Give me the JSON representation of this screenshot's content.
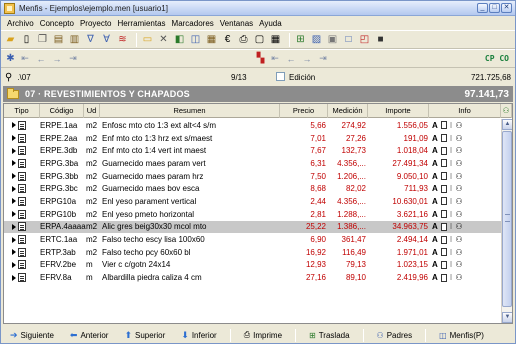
{
  "window": {
    "title": "Menfis - Ejemplos\\ejemplo.men  [usuario1]",
    "controls": [
      "_",
      "□",
      "✕"
    ]
  },
  "menu": [
    "Archivo",
    "Concepto",
    "Proyecto",
    "Herramientas",
    "Marcadores",
    "Ventanas",
    "Ayuda"
  ],
  "toolbar2": {
    "code": "CP CO"
  },
  "pathbar": {
    "path": ".\\07",
    "pager": "9/13",
    "edit_label": "Edición",
    "total": "721.725,68"
  },
  "chapter": {
    "title": "07 · REVESTIMIENTOS Y CHAPADOS",
    "total": "97.141,73"
  },
  "columns": [
    "Tipo",
    "Código",
    "Ud",
    "Resumen",
    "Precio",
    "Medición",
    "Importe",
    "Info"
  ],
  "rows": [
    {
      "code": "ERPE.1aa",
      "ud": "m2",
      "resumen": "Enfosc mto cto 1:3 ext alt<4 s/m",
      "precio": "5,66",
      "medicion": "274,92",
      "importe": "1.556,05"
    },
    {
      "code": "ERPE.2aa",
      "ud": "m2",
      "resumen": "Enf mto cto 1:3 hrz ext s/maest",
      "precio": "7,01",
      "medicion": "27,26",
      "importe": "191,09"
    },
    {
      "code": "ERPE.3db",
      "ud": "m2",
      "resumen": "Enf mto cto 1:4 vert int maest",
      "precio": "7,67",
      "medicion": "132,73",
      "importe": "1.018,04"
    },
    {
      "code": "ERPG.3ba",
      "ud": "m2",
      "resumen": "Guarnecido maes param vert",
      "precio": "6,31",
      "medicion": "4.356,...",
      "importe": "27.491,34"
    },
    {
      "code": "ERPG.3bb",
      "ud": "m2",
      "resumen": "Guarnecido maes param hrz",
      "precio": "7,50",
      "medicion": "1.206,...",
      "importe": "9.050,10"
    },
    {
      "code": "ERPG.3bc",
      "ud": "m2",
      "resumen": "Guarnecido maes bov esca",
      "precio": "8,68",
      "medicion": "82,02",
      "importe": "711,93"
    },
    {
      "code": "ERPG10a",
      "ud": "m2",
      "resumen": "Enl yeso parament vertical",
      "precio": "2,44",
      "medicion": "4.356,...",
      "importe": "10.630,01"
    },
    {
      "code": "ERPG10b",
      "ud": "m2",
      "resumen": "Enl yeso pmeto horizontal",
      "precio": "2,81",
      "medicion": "1.288,...",
      "importe": "3.621,16"
    },
    {
      "code": "ERPA.4aaaa",
      "ud": "m2",
      "resumen": "Alic gres beig30x30 mcol mto",
      "precio": "25,22",
      "medicion": "1.386,...",
      "importe": "34.963,75",
      "selected": true
    },
    {
      "code": "ERTC.1aa",
      "ud": "m2",
      "resumen": "Falso techo escy lisa 100x60",
      "precio": "6,90",
      "medicion": "361,47",
      "importe": "2.494,14"
    },
    {
      "code": "ERTP.3ab",
      "ud": "m2",
      "resumen": "Falso techo pcy 60x60 bl",
      "precio": "16,92",
      "medicion": "116,49",
      "importe": "1.971,01"
    },
    {
      "code": "EFRV.2be",
      "ud": "m",
      "resumen": "Vier c c/gotn 24x14",
      "precio": "12,93",
      "medicion": "79,13",
      "importe": "1.023,15"
    },
    {
      "code": "EFRV.8a",
      "ud": "m",
      "resumen": "Albardilla piedra caliza 4 cm",
      "precio": "27,16",
      "medicion": "89,10",
      "importe": "2.419,96"
    }
  ],
  "bottom_buttons": [
    {
      "label": "Siguiente",
      "icon": "arrow-right-icon"
    },
    {
      "label": "Anterior",
      "icon": "arrow-left-icon"
    },
    {
      "label": "Superior",
      "icon": "arrow-up-icon"
    },
    {
      "label": "Inferior",
      "icon": "arrow-down-icon"
    },
    {
      "label": "Imprime",
      "icon": "printer-icon"
    },
    {
      "label": "Traslada",
      "icon": "transfer-icon"
    },
    {
      "label": "Padres",
      "icon": "tree-icon"
    },
    {
      "label": "Menfis(P)",
      "icon": "window-icon"
    }
  ],
  "colors": {
    "red_text": "#c00000",
    "chapter_bg": "#8c8c8c",
    "code_green": "#1a7f3c",
    "selected_row": "#c8c8c8"
  }
}
